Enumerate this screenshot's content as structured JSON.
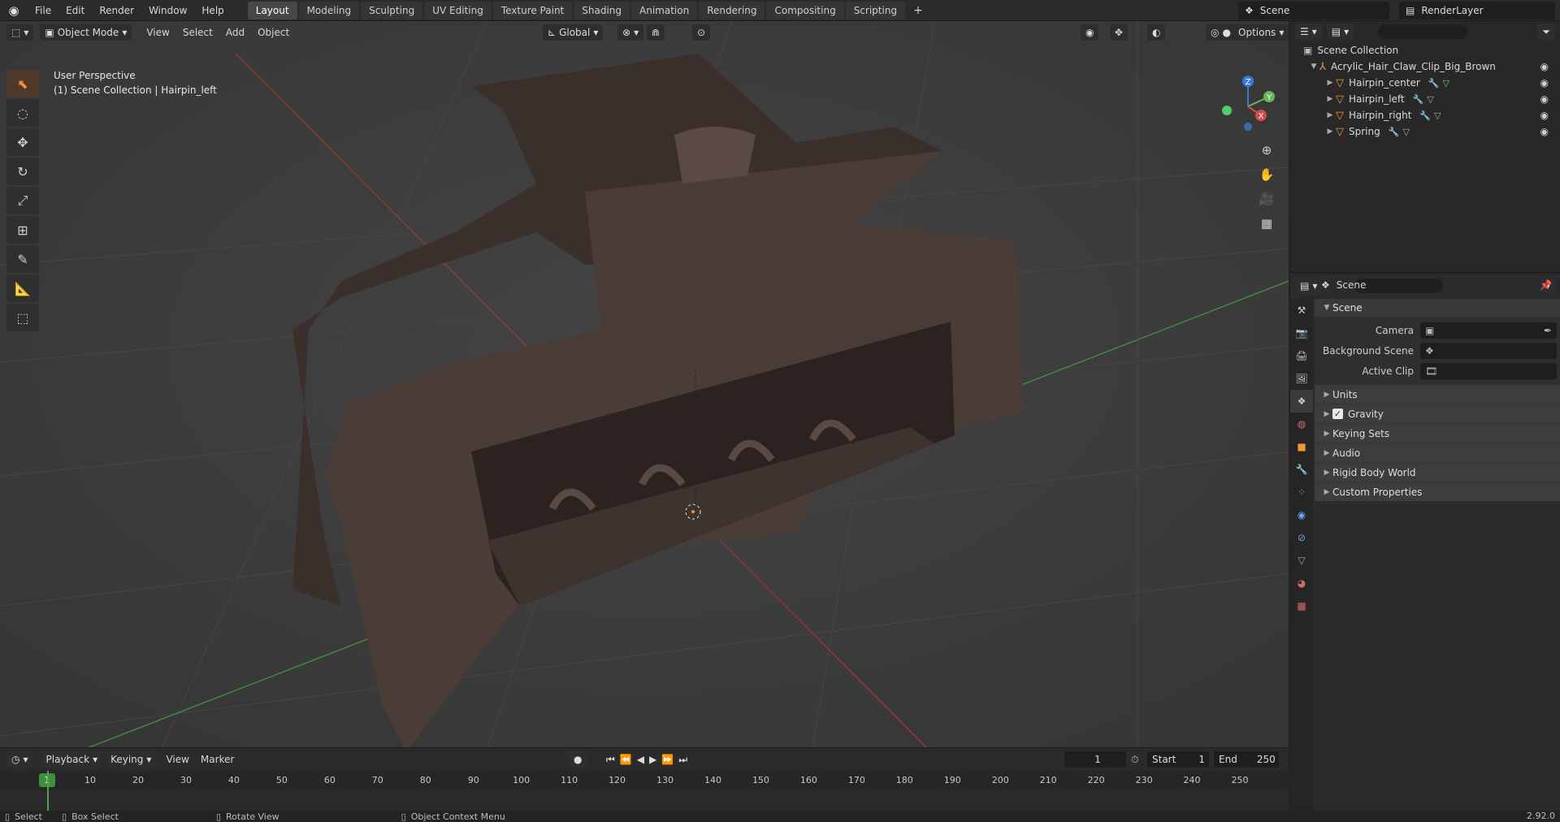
{
  "topbar": {
    "menu": [
      "File",
      "Edit",
      "Render",
      "Window",
      "Help"
    ],
    "workspaces": [
      "Layout",
      "Modeling",
      "Sculpting",
      "UV Editing",
      "Texture Paint",
      "Shading",
      "Animation",
      "Rendering",
      "Compositing",
      "Scripting"
    ],
    "active_workspace": "Layout",
    "add": "+",
    "scene": "Scene",
    "render_layer": "RenderLayer"
  },
  "viewport": {
    "mode": "Object Mode",
    "menu": [
      "View",
      "Select",
      "Add",
      "Object"
    ],
    "transform": "Global",
    "options": "Options",
    "info_line1": "User Perspective",
    "info_line2": "(1) Scene Collection | Hairpin_left",
    "gizmo": {
      "z": "Z",
      "y": "Y",
      "x": "X"
    }
  },
  "timeline": {
    "menu": [
      "Playback",
      "Keying",
      "View",
      "Marker"
    ],
    "current_frame": "1",
    "start_label": "Start",
    "start": "1",
    "end_label": "End",
    "end": "250",
    "ticks": [
      "10",
      "20",
      "30",
      "40",
      "50",
      "60",
      "70",
      "80",
      "90",
      "100",
      "110",
      "120",
      "130",
      "140",
      "150",
      "160",
      "170",
      "180",
      "190",
      "200",
      "210",
      "220",
      "230",
      "240",
      "250"
    ],
    "frame_badge": "1"
  },
  "status": {
    "select": "Select",
    "box_select": "Box Select",
    "rotate_view": "Rotate View",
    "context_menu": "Object Context Menu",
    "version": "2.92.0"
  },
  "outliner": {
    "root": "Scene Collection",
    "collection": "Acrylic_Hair_Claw_Clip_Big_Brown",
    "items": [
      "Hairpin_center",
      "Hairpin_left",
      "Hairpin_right",
      "Spring"
    ]
  },
  "properties": {
    "header": "Scene",
    "panel": "Scene",
    "camera_label": "Camera",
    "background_label": "Background Scene",
    "clip_label": "Active Clip",
    "sections": [
      "Units",
      "Gravity",
      "Keying Sets",
      "Audio",
      "Rigid Body World",
      "Custom Properties"
    ]
  }
}
